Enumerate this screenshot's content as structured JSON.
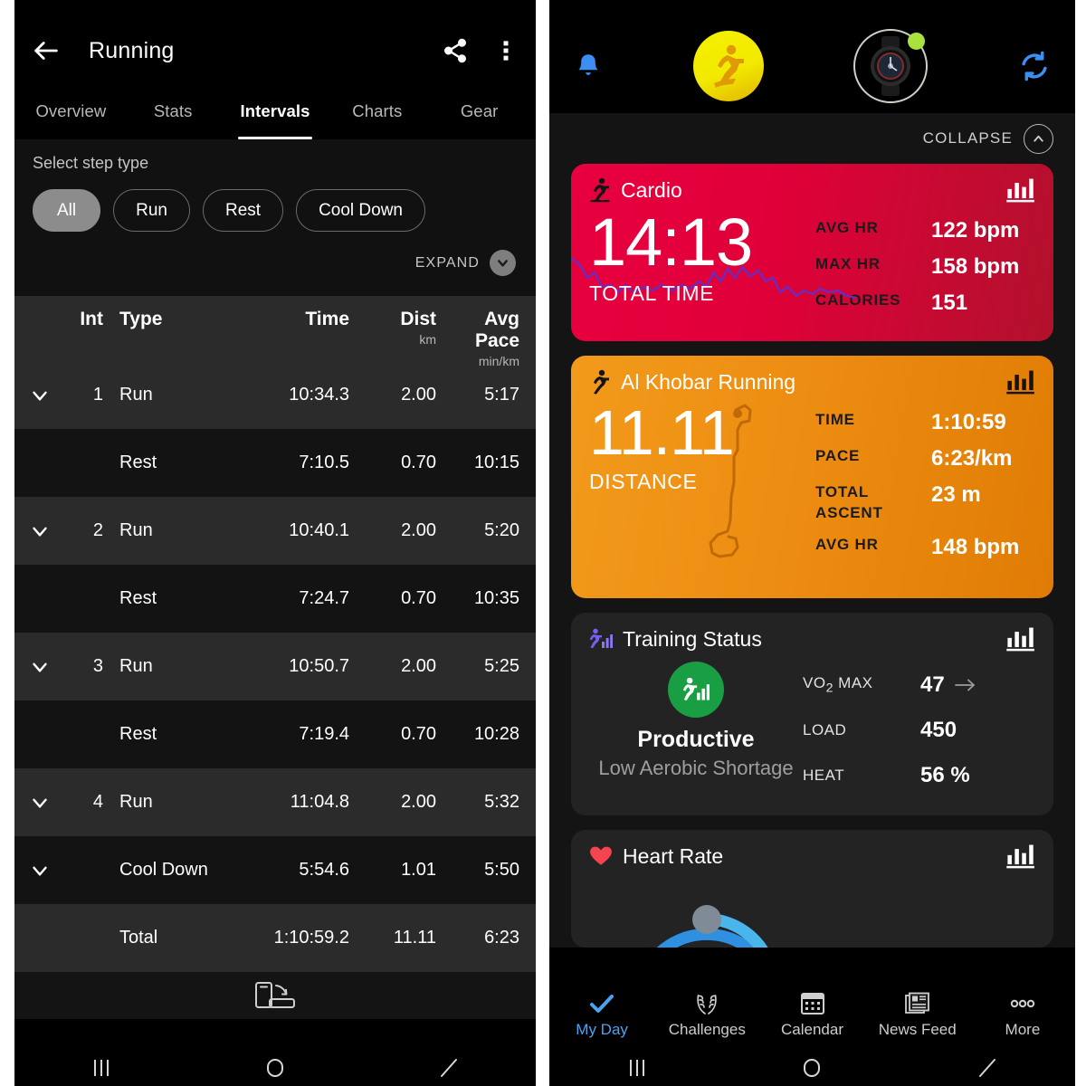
{
  "left": {
    "appbar": {
      "back_icon": "arrow-back-icon",
      "title": "Running",
      "share_icon": "share-icon",
      "overflow_icon": "more-vertical-icon"
    },
    "tabs": [
      {
        "label": "Overview",
        "active": false
      },
      {
        "label": "Stats",
        "active": false
      },
      {
        "label": "Intervals",
        "active": true
      },
      {
        "label": "Charts",
        "active": false
      },
      {
        "label": "Gear",
        "active": false
      }
    ],
    "filter": {
      "label": "Select step type",
      "chips": [
        {
          "label": "All",
          "selected": true
        },
        {
          "label": "Run",
          "selected": false
        },
        {
          "label": "Rest",
          "selected": false
        },
        {
          "label": "Cool Down",
          "selected": false
        }
      ],
      "expand_label": "EXPAND",
      "expand_icon": "chevron-down-icon"
    },
    "table": {
      "headers": {
        "int": "Int",
        "type": "Type",
        "time": "Time",
        "dist": "Dist",
        "dist_unit": "km",
        "pace": "Avg Pace",
        "pace_unit": "min/km"
      },
      "rows": [
        {
          "chevron": true,
          "int": "1",
          "type": "Run",
          "time": "10:34.3",
          "dist": "2.00",
          "pace": "5:17",
          "shade": "light"
        },
        {
          "chevron": false,
          "int": "",
          "type": "Rest",
          "time": "7:10.5",
          "dist": "0.70",
          "pace": "10:15",
          "shade": "dark"
        },
        {
          "chevron": true,
          "int": "2",
          "type": "Run",
          "time": "10:40.1",
          "dist": "2.00",
          "pace": "5:20",
          "shade": "light"
        },
        {
          "chevron": false,
          "int": "",
          "type": "Rest",
          "time": "7:24.7",
          "dist": "0.70",
          "pace": "10:35",
          "shade": "dark"
        },
        {
          "chevron": true,
          "int": "3",
          "type": "Run",
          "time": "10:50.7",
          "dist": "2.00",
          "pace": "5:25",
          "shade": "light"
        },
        {
          "chevron": false,
          "int": "",
          "type": "Rest",
          "time": "7:19.4",
          "dist": "0.70",
          "pace": "10:28",
          "shade": "dark"
        },
        {
          "chevron": true,
          "int": "4",
          "type": "Run",
          "time": "11:04.8",
          "dist": "2.00",
          "pace": "5:32",
          "shade": "light"
        },
        {
          "chevron": true,
          "int": "",
          "type": "Cool Down",
          "time": "5:54.6",
          "dist": "1.01",
          "pace": "5:50",
          "shade": "dark"
        },
        {
          "chevron": false,
          "int": "",
          "type": "Total",
          "time": "1:10:59.2",
          "dist": "11.11",
          "pace": "6:23",
          "shade": "total"
        }
      ]
    },
    "rotate_icon": "rotate-screen-icon",
    "system_nav": [
      "recents-icon",
      "home-icon",
      "back-icon"
    ]
  },
  "right": {
    "topbar": {
      "bell_icon": "notification-bell-icon",
      "profile_icon": "runner-avatar-icon",
      "device_icon": "smartwatch-icon",
      "device_status_dot_color": "#a8e23c",
      "sync_icon": "sync-refresh-icon"
    },
    "collapse": {
      "label": "COLLAPSE",
      "icon": "chevron-up-icon"
    },
    "cards": [
      {
        "id": "cardio",
        "icon": "running-person-icon",
        "title": "Cardio",
        "chart_icon": "bar-chart-icon",
        "big_value": "14:13",
        "big_label": "TOTAL TIME",
        "accent": "#e8003f",
        "stats": [
          {
            "key": "AVG HR",
            "value": "122 bpm"
          },
          {
            "key": "MAX HR",
            "value": "158 bpm"
          },
          {
            "key": "CALORIES",
            "value": "151"
          }
        ]
      },
      {
        "id": "activity",
        "icon": "running-person-icon",
        "title": "Al Khobar Running",
        "chart_icon": "bar-chart-icon",
        "big_value": "11.11",
        "big_label": "DISTANCE",
        "accent": "#ed8d11",
        "route_icon": "route-map-icon",
        "stats": [
          {
            "key": "TIME",
            "value": "1:10:59"
          },
          {
            "key": "PACE",
            "value": "6:23/km"
          },
          {
            "key": "TOTAL ASCENT",
            "value": "23 m"
          },
          {
            "key": "AVG HR",
            "value": "148 bpm"
          }
        ]
      },
      {
        "id": "training-status",
        "icon": "training-status-icon",
        "title": "Training Status",
        "chart_icon": "bar-chart-icon",
        "badge_icon": "training-status-icon",
        "badge_color": "#1a9e43",
        "status": "Productive",
        "status_sub": "Low Aerobic Shortage",
        "stats": [
          {
            "key": "VO2 MAX",
            "key_sub": "2",
            "value": "47",
            "trend_icon": "arrow-right-icon"
          },
          {
            "key": "LOAD",
            "value": "450"
          },
          {
            "key": "HEAT",
            "value": "56 %"
          }
        ]
      },
      {
        "id": "heart-rate",
        "icon": "heart-icon",
        "title": "Heart Rate",
        "chart_icon": "bar-chart-icon",
        "gauge_icon": "heart-rate-gauge-icon"
      }
    ],
    "bottom_nav": [
      {
        "label": "My Day",
        "icon": "check-icon",
        "active": true
      },
      {
        "label": "Challenges",
        "icon": "laurel-icon",
        "active": false
      },
      {
        "label": "Calendar",
        "icon": "calendar-icon",
        "active": false
      },
      {
        "label": "News Feed",
        "icon": "news-icon",
        "active": false
      },
      {
        "label": "More",
        "icon": "more-dots-icon",
        "active": false
      }
    ],
    "system_nav": [
      "recents-icon",
      "home-icon",
      "back-icon"
    ]
  }
}
